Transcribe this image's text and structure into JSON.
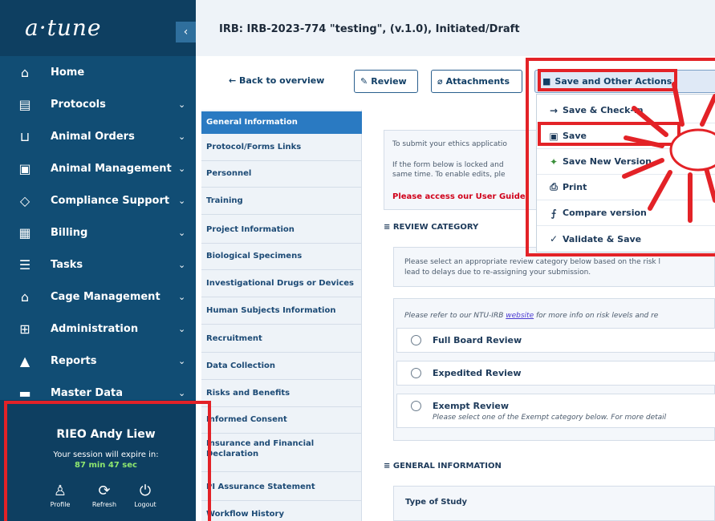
{
  "nav": {
    "logo": "a·tune",
    "collapse_icon": "‹",
    "items": [
      {
        "label": "Home",
        "icon": "⌂",
        "has_chevron": false
      },
      {
        "label": "Protocols",
        "icon": "▤",
        "has_chevron": true
      },
      {
        "label": "Animal Orders",
        "icon": "⊔",
        "has_chevron": true
      },
      {
        "label": "Animal Management",
        "icon": "▣",
        "has_chevron": true
      },
      {
        "label": "Compliance Support",
        "icon": "◇",
        "has_chevron": true
      },
      {
        "label": "Billing",
        "icon": "▦",
        "has_chevron": true
      },
      {
        "label": "Tasks",
        "icon": "☰",
        "has_chevron": true
      },
      {
        "label": "Cage Management",
        "icon": "⌂",
        "has_chevron": true
      },
      {
        "label": "Administration",
        "icon": "⊞",
        "has_chevron": true
      },
      {
        "label": "Reports",
        "icon": "▲",
        "has_chevron": true
      },
      {
        "label": "Master Data",
        "icon": "▬",
        "has_chevron": true
      }
    ],
    "chevron": "⌄",
    "user": {
      "name": "RIEO Andy Liew",
      "session_text": "Your session will expire in:",
      "session_time": "87 min 47 sec",
      "actions": [
        {
          "label": "Profile",
          "icon": "♙"
        },
        {
          "label": "Refresh",
          "icon": "⟳"
        },
        {
          "label": "Logout",
          "icon": "⏻"
        }
      ]
    }
  },
  "header": {
    "title": "IRB: IRB-2023-774 \"testing\", (v.1.0), Initiated/Draft"
  },
  "toolbar": {
    "back_label": "← Back to overview",
    "review_label": "Review",
    "review_icon": "✎",
    "attachments_label": "Attachments",
    "attachments_icon": "⌀",
    "save_other_label": "Save and Other Actions",
    "save_other_icon": "■"
  },
  "menu": {
    "items": [
      {
        "label": "Save & Check-in",
        "icon": "→"
      },
      {
        "label": "Save",
        "icon": "▣"
      },
      {
        "label": "Save New Version",
        "icon": "✦"
      },
      {
        "label": "Print",
        "icon": "⎙"
      },
      {
        "label": "Compare version",
        "icon": "⨍"
      },
      {
        "label": "Validate & Save",
        "icon": "✓"
      }
    ]
  },
  "sections": [
    {
      "label": "General Information",
      "active": true
    },
    {
      "label": "Protocol/Forms Links"
    },
    {
      "label": "Personnel"
    },
    {
      "label": "Training"
    },
    {
      "label": "Project Information"
    },
    {
      "label": "Biological Specimens"
    },
    {
      "label": "Investigational Drugs or Devices"
    },
    {
      "label": "Human Subjects Information"
    },
    {
      "label": "Recruitment"
    },
    {
      "label": "Data Collection"
    },
    {
      "label": "Risks and Benefits"
    },
    {
      "label": "Informed Consent"
    },
    {
      "label": "Insurance and Financial Declaration"
    },
    {
      "label": "PI Assurance Statement"
    },
    {
      "label": "Workflow History"
    }
  ],
  "main": {
    "info_line1": "To submit your ethics applicatio",
    "info_line2": "If the form below is locked and",
    "info_line3": "same time. To enable edits, ple",
    "guide_link": "Please access our User Guide",
    "review_category_title": "≡  REVIEW CATEGORY",
    "review_desc1": "Please select an appropriate review category below based on the risk l",
    "review_desc2": "lead to delays due to re-assigning your submission.",
    "refer_prefix": "Please refer to our NTU-IRB ",
    "refer_link": "website",
    "refer_suffix": " for more info on risk levels and re",
    "options": [
      {
        "label": "Full Board Review"
      },
      {
        "label": "Expedited Review"
      },
      {
        "label": "Exempt Review",
        "note": "Please select one of the Exempt category below. For more detail"
      }
    ],
    "general_info_title": "≡  GENERAL INFORMATION",
    "type_of_study": "Type of Study"
  },
  "colors": {
    "nav_bg": "#114d74",
    "nav_dark": "#0e3f61",
    "accent": "#2a7ac2",
    "annotation_red": "#e32227",
    "link_red": "#d0021b"
  }
}
